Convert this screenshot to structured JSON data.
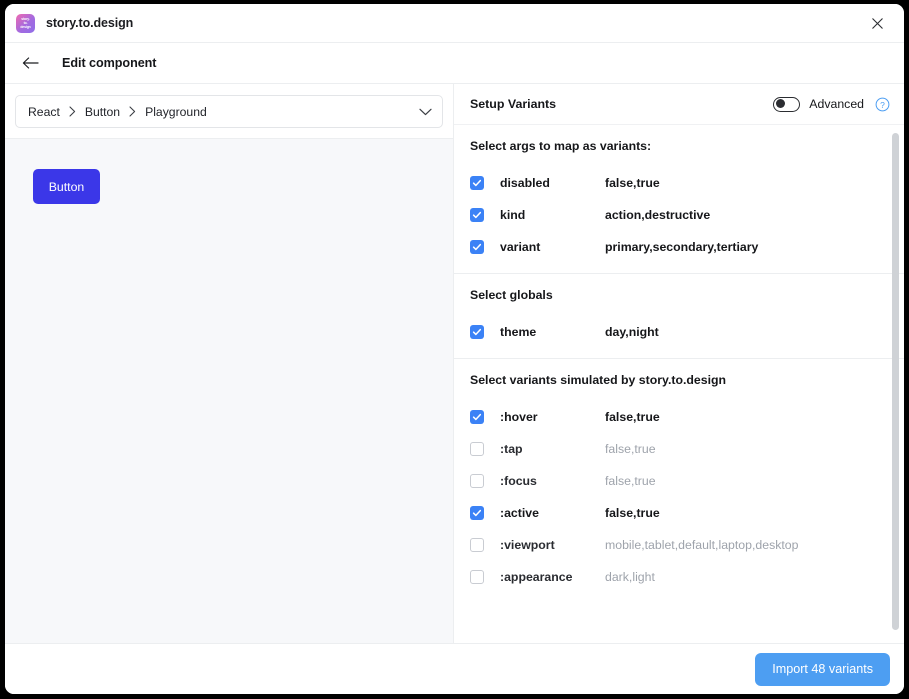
{
  "window": {
    "app_title": "story.to.design",
    "logo_lines": [
      "story.",
      "to.",
      "design"
    ],
    "close_icon": "close-icon"
  },
  "subheader": {
    "back_icon": "arrow-left-icon",
    "title": "Edit component"
  },
  "left": {
    "breadcrumb": {
      "items": [
        "React",
        "Button",
        "Playground"
      ],
      "separator_icon": "chevron-right-icon",
      "expand_icon": "chevron-down-icon"
    },
    "canvas": {
      "preview_button_label": "Button",
      "preview_button_color": "#3b37e8",
      "background": "#f7f8fa"
    }
  },
  "panel": {
    "title": "Setup Variants",
    "advanced_label": "Advanced",
    "advanced_enabled": false,
    "help_icon": "question-circle-icon",
    "sections": [
      {
        "title": "Select args to map as variants:",
        "rows": [
          {
            "checked": true,
            "label": "disabled",
            "values": "false,true"
          },
          {
            "checked": true,
            "label": "kind",
            "values": "action,destructive"
          },
          {
            "checked": true,
            "label": "variant",
            "values": "primary,secondary,tertiary"
          }
        ]
      },
      {
        "title": "Select globals",
        "rows": [
          {
            "checked": true,
            "label": "theme",
            "values": "day,night"
          }
        ]
      },
      {
        "title": "Select variants simulated by story.to.design",
        "rows": [
          {
            "checked": true,
            "label": ":hover",
            "values": "false,true"
          },
          {
            "checked": false,
            "label": ":tap",
            "values": "false,true"
          },
          {
            "checked": false,
            "label": ":focus",
            "values": "false,true"
          },
          {
            "checked": true,
            "label": ":active",
            "values": "false,true"
          },
          {
            "checked": false,
            "label": ":viewport",
            "values": "mobile,tablet,default,laptop,desktop"
          },
          {
            "checked": false,
            "label": ":appearance",
            "values": "dark,light"
          }
        ]
      }
    ]
  },
  "footer": {
    "import_label": "Import 48 variants",
    "import_color": "#4d9ef2"
  },
  "colors": {
    "checkbox_on": "#3b82f6",
    "accent_help": "#4d9ef2",
    "text": "#16171a",
    "text_dim": "#9ea3ab",
    "border": "#eceef0"
  }
}
